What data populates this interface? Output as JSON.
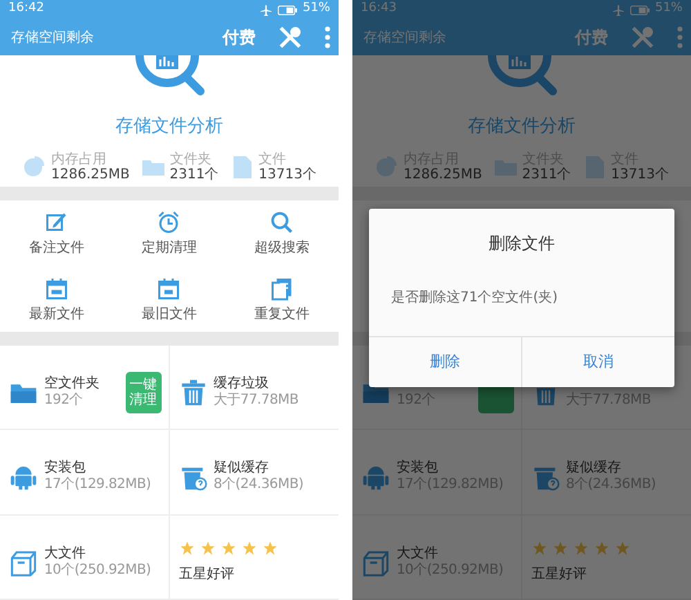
{
  "screens": [
    {
      "status_bar": {
        "time": "16:42",
        "battery": "51%"
      },
      "app_bar": {
        "title": "存储空间剩余",
        "action": "付费"
      },
      "analysis": {
        "title": "存储文件分析",
        "stats": [
          {
            "kind": "memory",
            "label": "内存占用",
            "value": "1286.25MB"
          },
          {
            "kind": "folder",
            "label": "文件夹",
            "value": "2311个"
          },
          {
            "kind": "file",
            "label": "文件",
            "value": "13713个"
          }
        ]
      },
      "tools": [
        {
          "kind": "note",
          "label": "备注文件"
        },
        {
          "kind": "alarm",
          "label": "定期清理"
        },
        {
          "kind": "search",
          "label": "超级搜索"
        },
        {
          "kind": "new",
          "label": "最新文件"
        },
        {
          "kind": "old",
          "label": "最旧文件"
        },
        {
          "kind": "duplicate",
          "label": "重复文件"
        }
      ],
      "cards": [
        {
          "kind": "folder",
          "title": "空文件夹",
          "subtitle": "192个",
          "action": "一键清理"
        },
        {
          "kind": "trash",
          "title": "缓存垃圾",
          "subtitle": "大于77.78MB"
        },
        {
          "kind": "apk",
          "title": "安装包",
          "subtitle": "17个(129.82MB)"
        },
        {
          "kind": "suspect",
          "title": "疑似缓存",
          "subtitle": "8个(24.36MB)"
        },
        {
          "kind": "large",
          "title": "大文件",
          "subtitle": "10个(250.92MB)"
        },
        {
          "kind": "rating",
          "title": "五星好评",
          "stars": 5
        }
      ],
      "dimmed": false
    },
    {
      "status_bar": {
        "time": "16:43",
        "battery": "51%"
      },
      "app_bar": {
        "title": "存储空间剩余",
        "action": "付费"
      },
      "analysis": {
        "title": "存储文件分析",
        "stats": [
          {
            "kind": "memory",
            "label": "内存占用",
            "value": "1286.25MB"
          },
          {
            "kind": "folder",
            "label": "文件夹",
            "value": "2311个"
          },
          {
            "kind": "file",
            "label": "文件",
            "value": "13713个"
          }
        ]
      },
      "cards": [
        {
          "kind": "folder",
          "subtitle": "192个"
        },
        {
          "kind": "trash",
          "subtitle": "大于77.78MB"
        },
        {
          "kind": "apk",
          "title": "安装包",
          "subtitle": "17个(129.82MB)"
        },
        {
          "kind": "suspect",
          "title": "疑似缓存",
          "subtitle": "8个(24.36MB)"
        },
        {
          "kind": "large",
          "title": "大文件",
          "subtitle": "10个(250.92MB)"
        },
        {
          "kind": "rating",
          "title": "五星好评",
          "stars": 5
        }
      ],
      "dimmed": true,
      "dialog": {
        "title": "删除文件",
        "message": "是否删除这71个空文件(夹)",
        "buttons": [
          "删除",
          "取消"
        ]
      }
    }
  ]
}
